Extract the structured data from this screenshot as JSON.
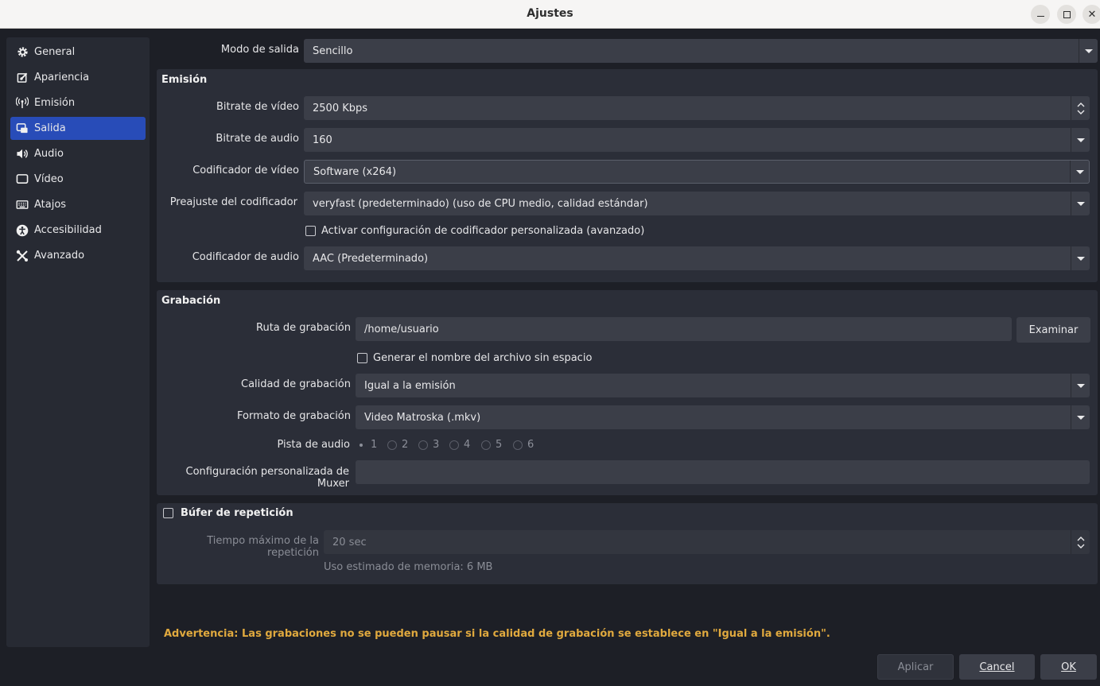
{
  "window": {
    "title": "Ajustes",
    "controls": [
      "minimize",
      "maximize",
      "close"
    ]
  },
  "sidebar": {
    "items": [
      {
        "label": "General",
        "icon": "gear-icon",
        "active": false
      },
      {
        "label": "Apariencia",
        "icon": "appearance-icon",
        "active": false
      },
      {
        "label": "Emisión",
        "icon": "broadcast-icon",
        "active": false
      },
      {
        "label": "Salida",
        "icon": "output-icon",
        "active": true
      },
      {
        "label": "Audio",
        "icon": "speaker-icon",
        "active": false
      },
      {
        "label": "Vídeo",
        "icon": "monitor-icon",
        "active": false
      },
      {
        "label": "Atajos",
        "icon": "keyboard-icon",
        "active": false
      },
      {
        "label": "Accesibilidad",
        "icon": "accessibility-icon",
        "active": false
      },
      {
        "label": "Avanzado",
        "icon": "tools-icon",
        "active": false
      }
    ]
  },
  "output_mode": {
    "label": "Modo de salida",
    "value": "Sencillo"
  },
  "streaming": {
    "title": "Emisión",
    "video_bitrate": {
      "label": "Bitrate de vídeo",
      "value": "2500 Kbps"
    },
    "audio_bitrate": {
      "label": "Bitrate de audio",
      "value": "160"
    },
    "video_encoder": {
      "label": "Codificador de vídeo",
      "value": "Software (x264)"
    },
    "encoder_preset": {
      "label": "Preajuste del codificador",
      "value": "veryfast (predeterminado) (uso de CPU medio, calidad estándar)"
    },
    "custom_encoder": {
      "label": "Activar configuración de codificador personalizada (avanzado)",
      "checked": false
    },
    "audio_encoder": {
      "label": "Codificador de audio",
      "value": "AAC (Predeterminado)"
    }
  },
  "recording": {
    "title": "Grabación",
    "path": {
      "label": "Ruta de grabación",
      "value": "/home/usuario",
      "browse": "Examinar"
    },
    "no_space": {
      "label": "Generar el nombre del archivo sin espacio",
      "checked": false
    },
    "quality": {
      "label": "Calidad de grabación",
      "value": "Igual a la emisión"
    },
    "format": {
      "label": "Formato de grabación",
      "value": "Video Matroska (.mkv)"
    },
    "audio_track": {
      "label": "Pista de audio",
      "options": [
        "1",
        "2",
        "3",
        "4",
        "5",
        "6"
      ],
      "selected": "1"
    },
    "muxer": {
      "label": "Configuración personalizada de Muxer",
      "value": ""
    }
  },
  "replay_buffer": {
    "title": "Búfer de repetición",
    "checked": false,
    "max_time": {
      "label": "Tiempo máximo de la repetición",
      "value": "20 sec"
    },
    "memory": "Uso estimado de memoria: 6 MB"
  },
  "warning": "Advertencia: Las grabaciones no se pueden pausar si la calidad de grabación se establece en \"Igual a la emisión\".",
  "buttons": {
    "apply": "Aplicar",
    "cancel": "Cancel",
    "ok": "OK"
  },
  "colors": {
    "accent": "#284cb8",
    "warning": "#e0a93e",
    "background": "#1d1f26",
    "panel": "#2b2e38",
    "field": "#3b3e48"
  }
}
